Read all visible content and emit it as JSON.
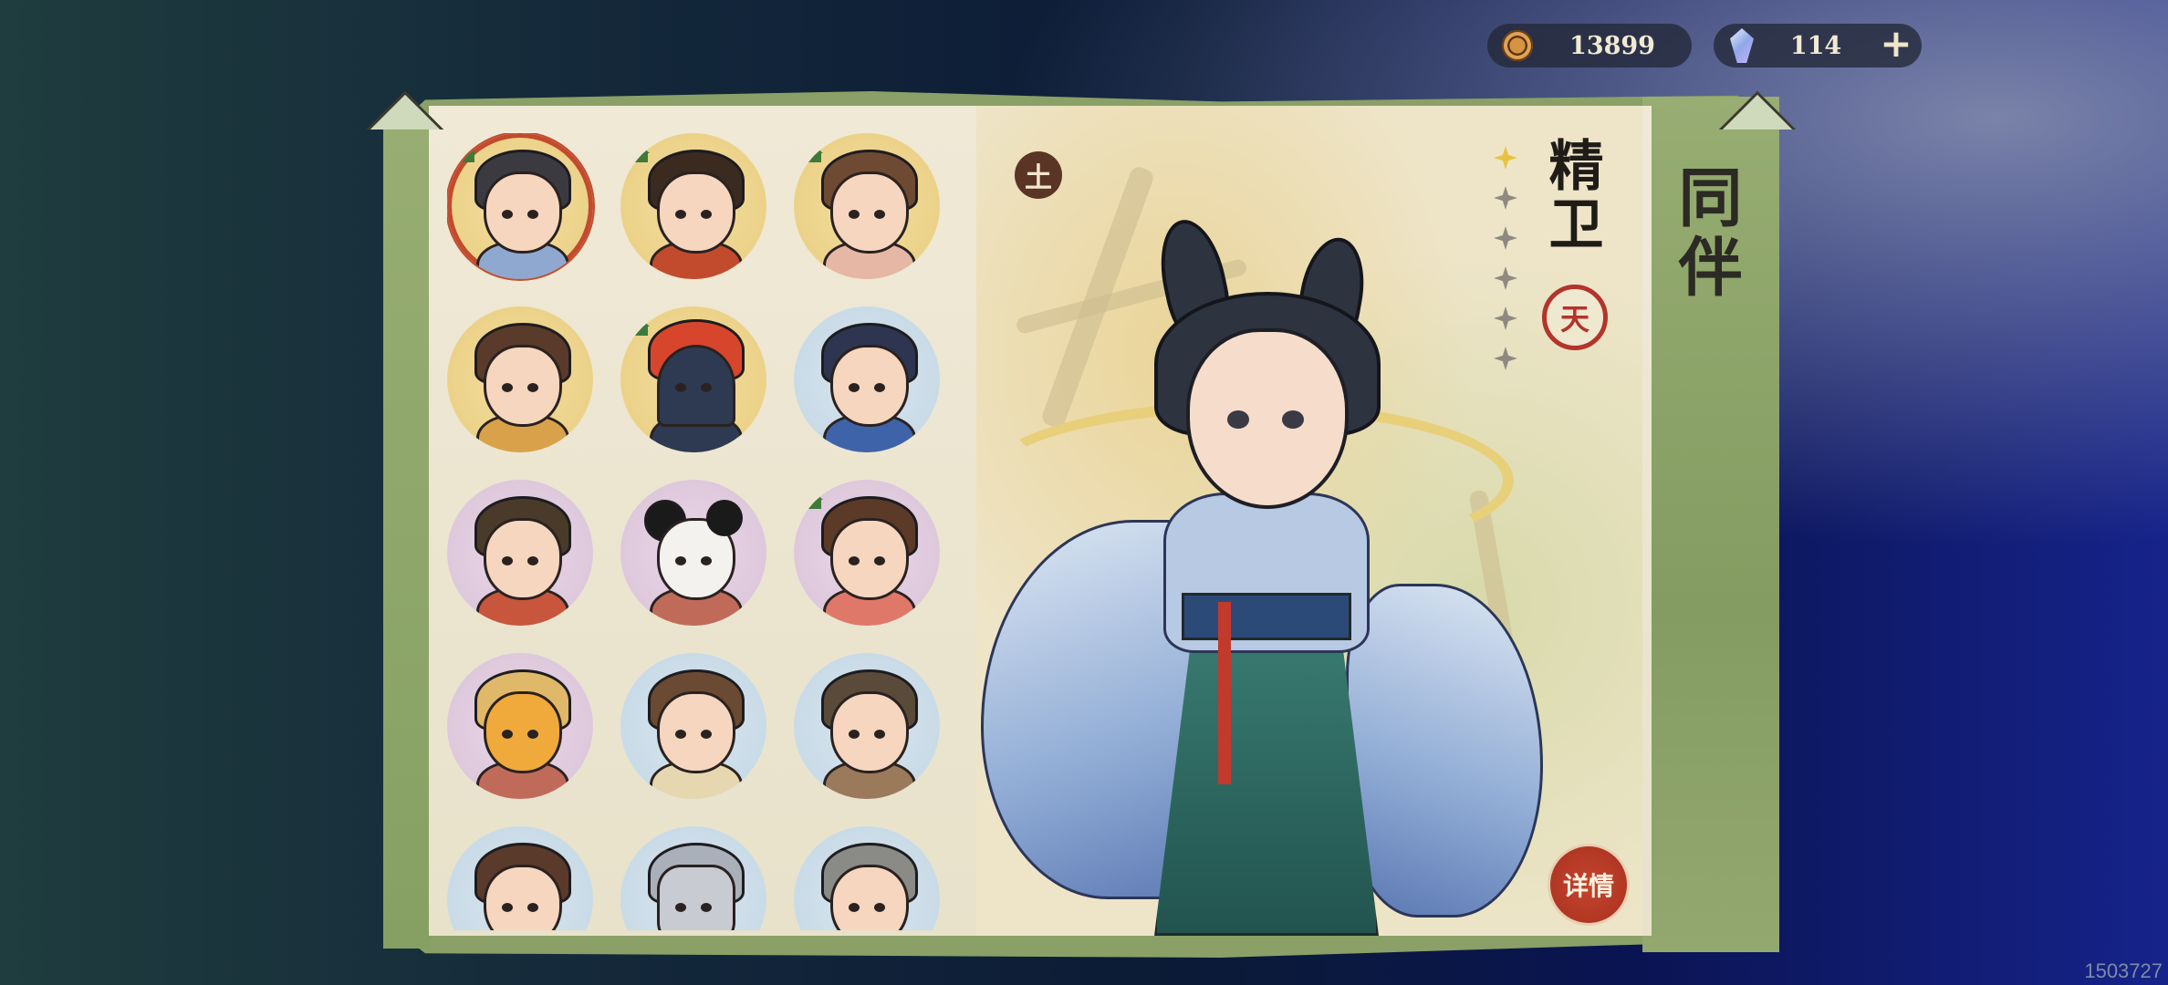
{
  "currency": {
    "coins": "13899",
    "gems": "114",
    "coin_icon": "copper-coin-icon",
    "gem_icon": "crystal-gem-icon",
    "add_icon": "plus-icon",
    "add_label": "+"
  },
  "panel": {
    "title": "同伴"
  },
  "roster": [
    {
      "style": "gold",
      "selected": true,
      "flag": true,
      "kind": "girl-buns"
    },
    {
      "style": "gold",
      "selected": false,
      "flag": true,
      "kind": "boy-red"
    },
    {
      "style": "gold",
      "selected": false,
      "flag": true,
      "kind": "flower-girl"
    },
    {
      "style": "gold",
      "selected": false,
      "flag": false,
      "kind": "lotus-goddess"
    },
    {
      "style": "gold",
      "selected": false,
      "flag": true,
      "kind": "bird"
    },
    {
      "style": "purple",
      "selected": false,
      "flag": false,
      "kind": "blue-girl"
    },
    {
      "style": "purple",
      "selected": false,
      "flag": false,
      "kind": "bearded-man"
    },
    {
      "style": "purple",
      "selected": false,
      "flag": false,
      "kind": "panda"
    },
    {
      "style": "purple",
      "selected": false,
      "flag": true,
      "kind": "bunny-girl"
    },
    {
      "style": "purple",
      "selected": false,
      "flag": false,
      "kind": "tiger"
    },
    {
      "style": "blue",
      "selected": false,
      "flag": false,
      "kind": "braid-girl"
    },
    {
      "style": "blue",
      "selected": false,
      "flag": false,
      "kind": "old-man"
    },
    {
      "style": "blue",
      "selected": false,
      "flag": false,
      "kind": "headband-kid"
    },
    {
      "style": "blue",
      "selected": false,
      "flag": false,
      "kind": "rock"
    },
    {
      "style": "blue",
      "selected": false,
      "flag": false,
      "kind": "monk"
    }
  ],
  "character": {
    "name": "精卫",
    "element": "土",
    "rank": "天",
    "stars_lit": 1,
    "stars_total": 6,
    "detail_button": "详情"
  },
  "build_id": "1503727"
}
